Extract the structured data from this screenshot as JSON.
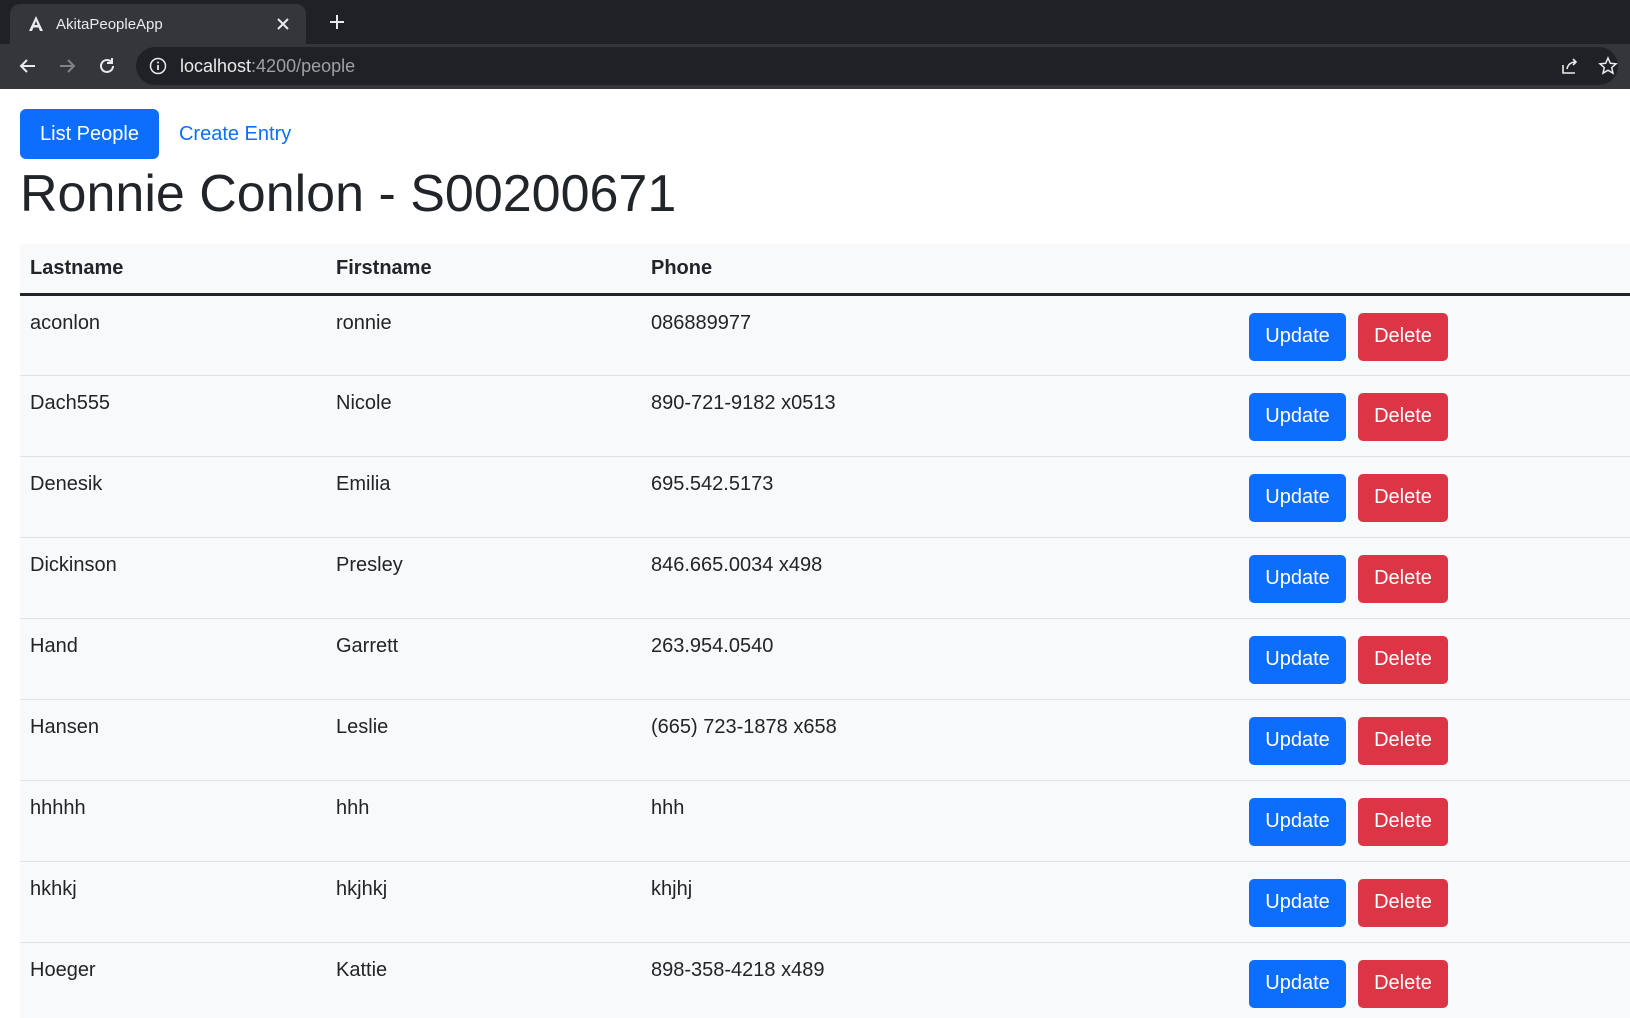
{
  "browser": {
    "tab_title": "AkitaPeopleApp",
    "url_host": "localhost",
    "url_path": ":4200/people"
  },
  "nav": {
    "list_people_label": "List People",
    "create_entry_label": "Create Entry"
  },
  "page": {
    "heading": "Ronnie Conlon - S00200671"
  },
  "table": {
    "headers": {
      "lastname": "Lastname",
      "firstname": "Firstname",
      "phone": "Phone"
    },
    "update_label": "Update",
    "delete_label": "Delete",
    "rows": [
      {
        "lastname": "aconlon",
        "firstname": "ronnie",
        "phone": "086889977"
      },
      {
        "lastname": "Dach555",
        "firstname": "Nicole",
        "phone": "890-721-9182 x0513"
      },
      {
        "lastname": "Denesik",
        "firstname": "Emilia",
        "phone": "695.542.5173"
      },
      {
        "lastname": "Dickinson",
        "firstname": "Presley",
        "phone": "846.665.0034 x498"
      },
      {
        "lastname": "Hand",
        "firstname": "Garrett",
        "phone": "263.954.0540"
      },
      {
        "lastname": "Hansen",
        "firstname": "Leslie",
        "phone": "(665) 723-1878 x658"
      },
      {
        "lastname": "hhhhh",
        "firstname": "hhh",
        "phone": "hhh"
      },
      {
        "lastname": "hkhkj",
        "firstname": "hkjhkj",
        "phone": "khjhj"
      },
      {
        "lastname": "Hoeger",
        "firstname": "Kattie",
        "phone": "898-358-4218 x489"
      }
    ]
  },
  "colors": {
    "primary": "#0d6efd",
    "danger": "#dc3545",
    "text": "#212529",
    "row_bg": "#f8f9fa"
  }
}
